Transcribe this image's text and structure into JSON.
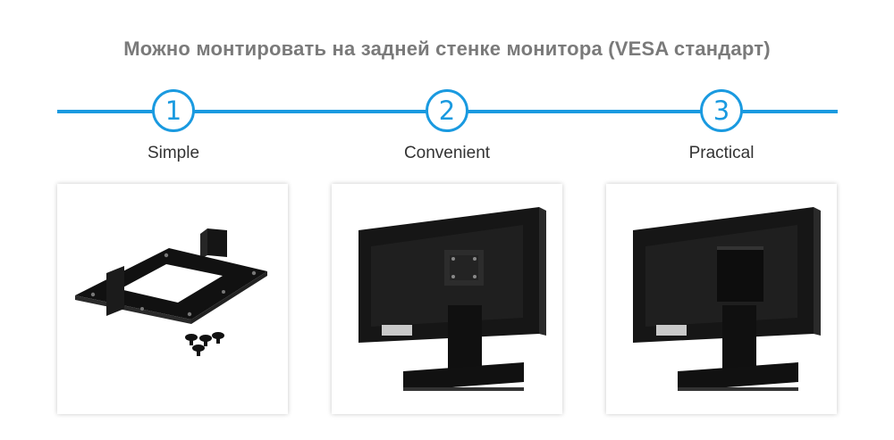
{
  "header": {
    "title": "Можно монтировать на задней стенке монитора (VESA стандарт)"
  },
  "accent_color": "#1a9ae0",
  "steps": [
    {
      "number": "1",
      "label": "Simple"
    },
    {
      "number": "2",
      "label": "Convenient"
    },
    {
      "number": "3",
      "label": "Practical"
    }
  ],
  "images": [
    {
      "icon": "vesa-bracket-with-screws"
    },
    {
      "icon": "monitor-back-with-vesa-plate"
    },
    {
      "icon": "monitor-back-with-mini-pc-mounted"
    }
  ]
}
